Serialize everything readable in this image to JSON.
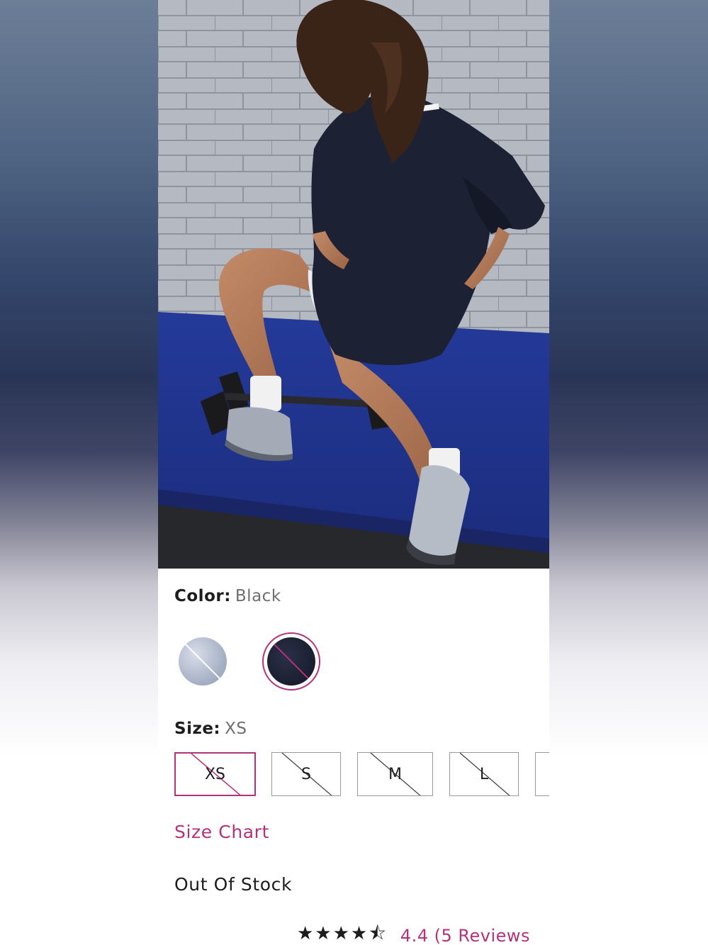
{
  "colors": {
    "accent": "#b5327a",
    "text": "#1d1d1d",
    "muted": "#6f6f6f",
    "border": "#9a9a9a"
  },
  "product": {
    "image_alt": "Model in oversized black tee kneeling on blue gym mat"
  },
  "color_selector": {
    "label": "Color:",
    "selected_value": "Black",
    "swatches": [
      {
        "name": "Light Heather",
        "selected": false,
        "available": false
      },
      {
        "name": "Black",
        "selected": true,
        "available": false
      }
    ]
  },
  "size_selector": {
    "label": "Size:",
    "selected_value": "XS",
    "options": [
      {
        "label": "XS",
        "selected": true,
        "available": false
      },
      {
        "label": "S",
        "selected": false,
        "available": false
      },
      {
        "label": "M",
        "selected": false,
        "available": false
      },
      {
        "label": "L",
        "selected": false,
        "available": false
      }
    ]
  },
  "size_chart_link": "Size Chart",
  "stock_status": "Out Of Stock",
  "rating": {
    "stars": "★★★★⯪",
    "value": 4.4,
    "text": "4.4 (5 Reviews"
  }
}
